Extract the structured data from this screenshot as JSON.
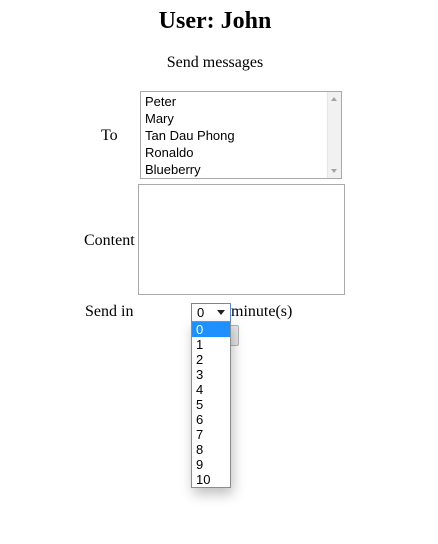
{
  "page": {
    "title": "User: John",
    "subtitle": "Send messages"
  },
  "form": {
    "to_label": "To",
    "content_label": "Content",
    "content_value": "",
    "send_in_label": "Send in",
    "unit_label": "minute(s)",
    "recipients": [
      "Peter",
      "Mary",
      "Tan Dau Phong",
      "Ronaldo",
      "Blueberry"
    ],
    "send_in": {
      "selected": "0",
      "options": [
        "0",
        "1",
        "2",
        "3",
        "4",
        "5",
        "6",
        "7",
        "8",
        "9",
        "10"
      ],
      "dropdown_open": true
    }
  },
  "colors": {
    "selection": "#1e90ff",
    "focus_border": "#5a8ad6"
  }
}
